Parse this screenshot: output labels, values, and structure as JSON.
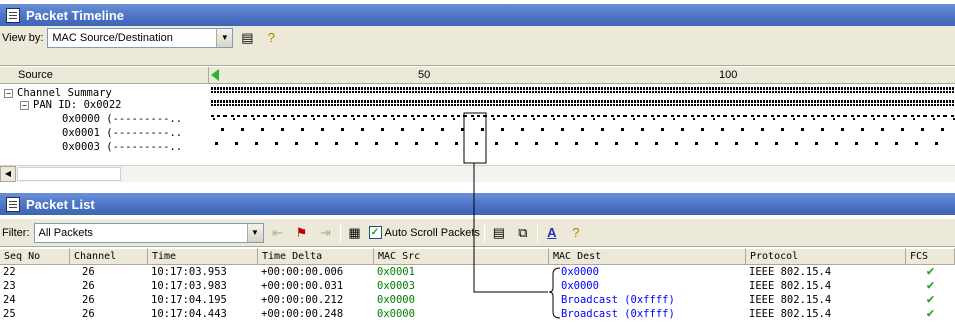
{
  "timeline": {
    "title": "Packet Timeline",
    "view_by_label": "View by:",
    "view_by_value": "MAC Source/Destination",
    "source_header": "Source",
    "ticks": [
      {
        "label": "50",
        "pos": 50
      },
      {
        "label": "100",
        "pos": 100
      }
    ],
    "tree": [
      {
        "label": "Channel Summary",
        "expander": "−",
        "level": 0
      },
      {
        "label": "PAN ID: 0x0022",
        "expander": "−",
        "level": 1
      },
      {
        "label": "0x0000 (---------..",
        "expander": "",
        "level": 2
      },
      {
        "label": "0x0001 (---------..",
        "expander": "",
        "level": 2
      },
      {
        "label": "0x0003 (---------..",
        "expander": "",
        "level": 2
      }
    ]
  },
  "packet_list": {
    "title": "Packet List",
    "filter_label": "Filter:",
    "filter_value": "All Packets",
    "auto_scroll_label": "Auto Scroll Packets",
    "auto_scroll_checked": true,
    "columns": [
      "Seq No",
      "Channel",
      "Time",
      "Time Delta",
      "MAC Src",
      "MAC Dest",
      "Protocol",
      "FCS"
    ],
    "rows": [
      {
        "seq": "22",
        "channel": "26",
        "time": "10:17:03.953",
        "delta": "+00:00:00.006",
        "src": "0x0001",
        "dest": "0x0000",
        "protocol": "IEEE 802.15.4",
        "fcs": "✔"
      },
      {
        "seq": "23",
        "channel": "26",
        "time": "10:17:03.983",
        "delta": "+00:00:00.031",
        "src": "0x0003",
        "dest": "0x0000",
        "protocol": "IEEE 802.15.4",
        "fcs": "✔"
      },
      {
        "seq": "24",
        "channel": "26",
        "time": "10:17:04.195",
        "delta": "+00:00:00.212",
        "src": "0x0000",
        "dest": "Broadcast (0xffff)",
        "protocol": "IEEE 802.15.4",
        "fcs": "✔"
      },
      {
        "seq": "25",
        "channel": "26",
        "time": "10:17:04.443",
        "delta": "+00:00:00.248",
        "src": "0x0000",
        "dest": "Broadcast (0xffff)",
        "protocol": "IEEE 802.15.4",
        "fcs": "✔"
      }
    ]
  },
  "colors": {
    "title_bar": "#4f77c6",
    "src_text": "#008000",
    "dest_text": "#0000ff",
    "fcs_ok": "#2ca12c",
    "timeline_marker": "#2cb52c"
  },
  "icons": {
    "panel": "document-icon",
    "properties": "properties-icon",
    "help": "help-question-icon",
    "font": "font-A-icon"
  }
}
